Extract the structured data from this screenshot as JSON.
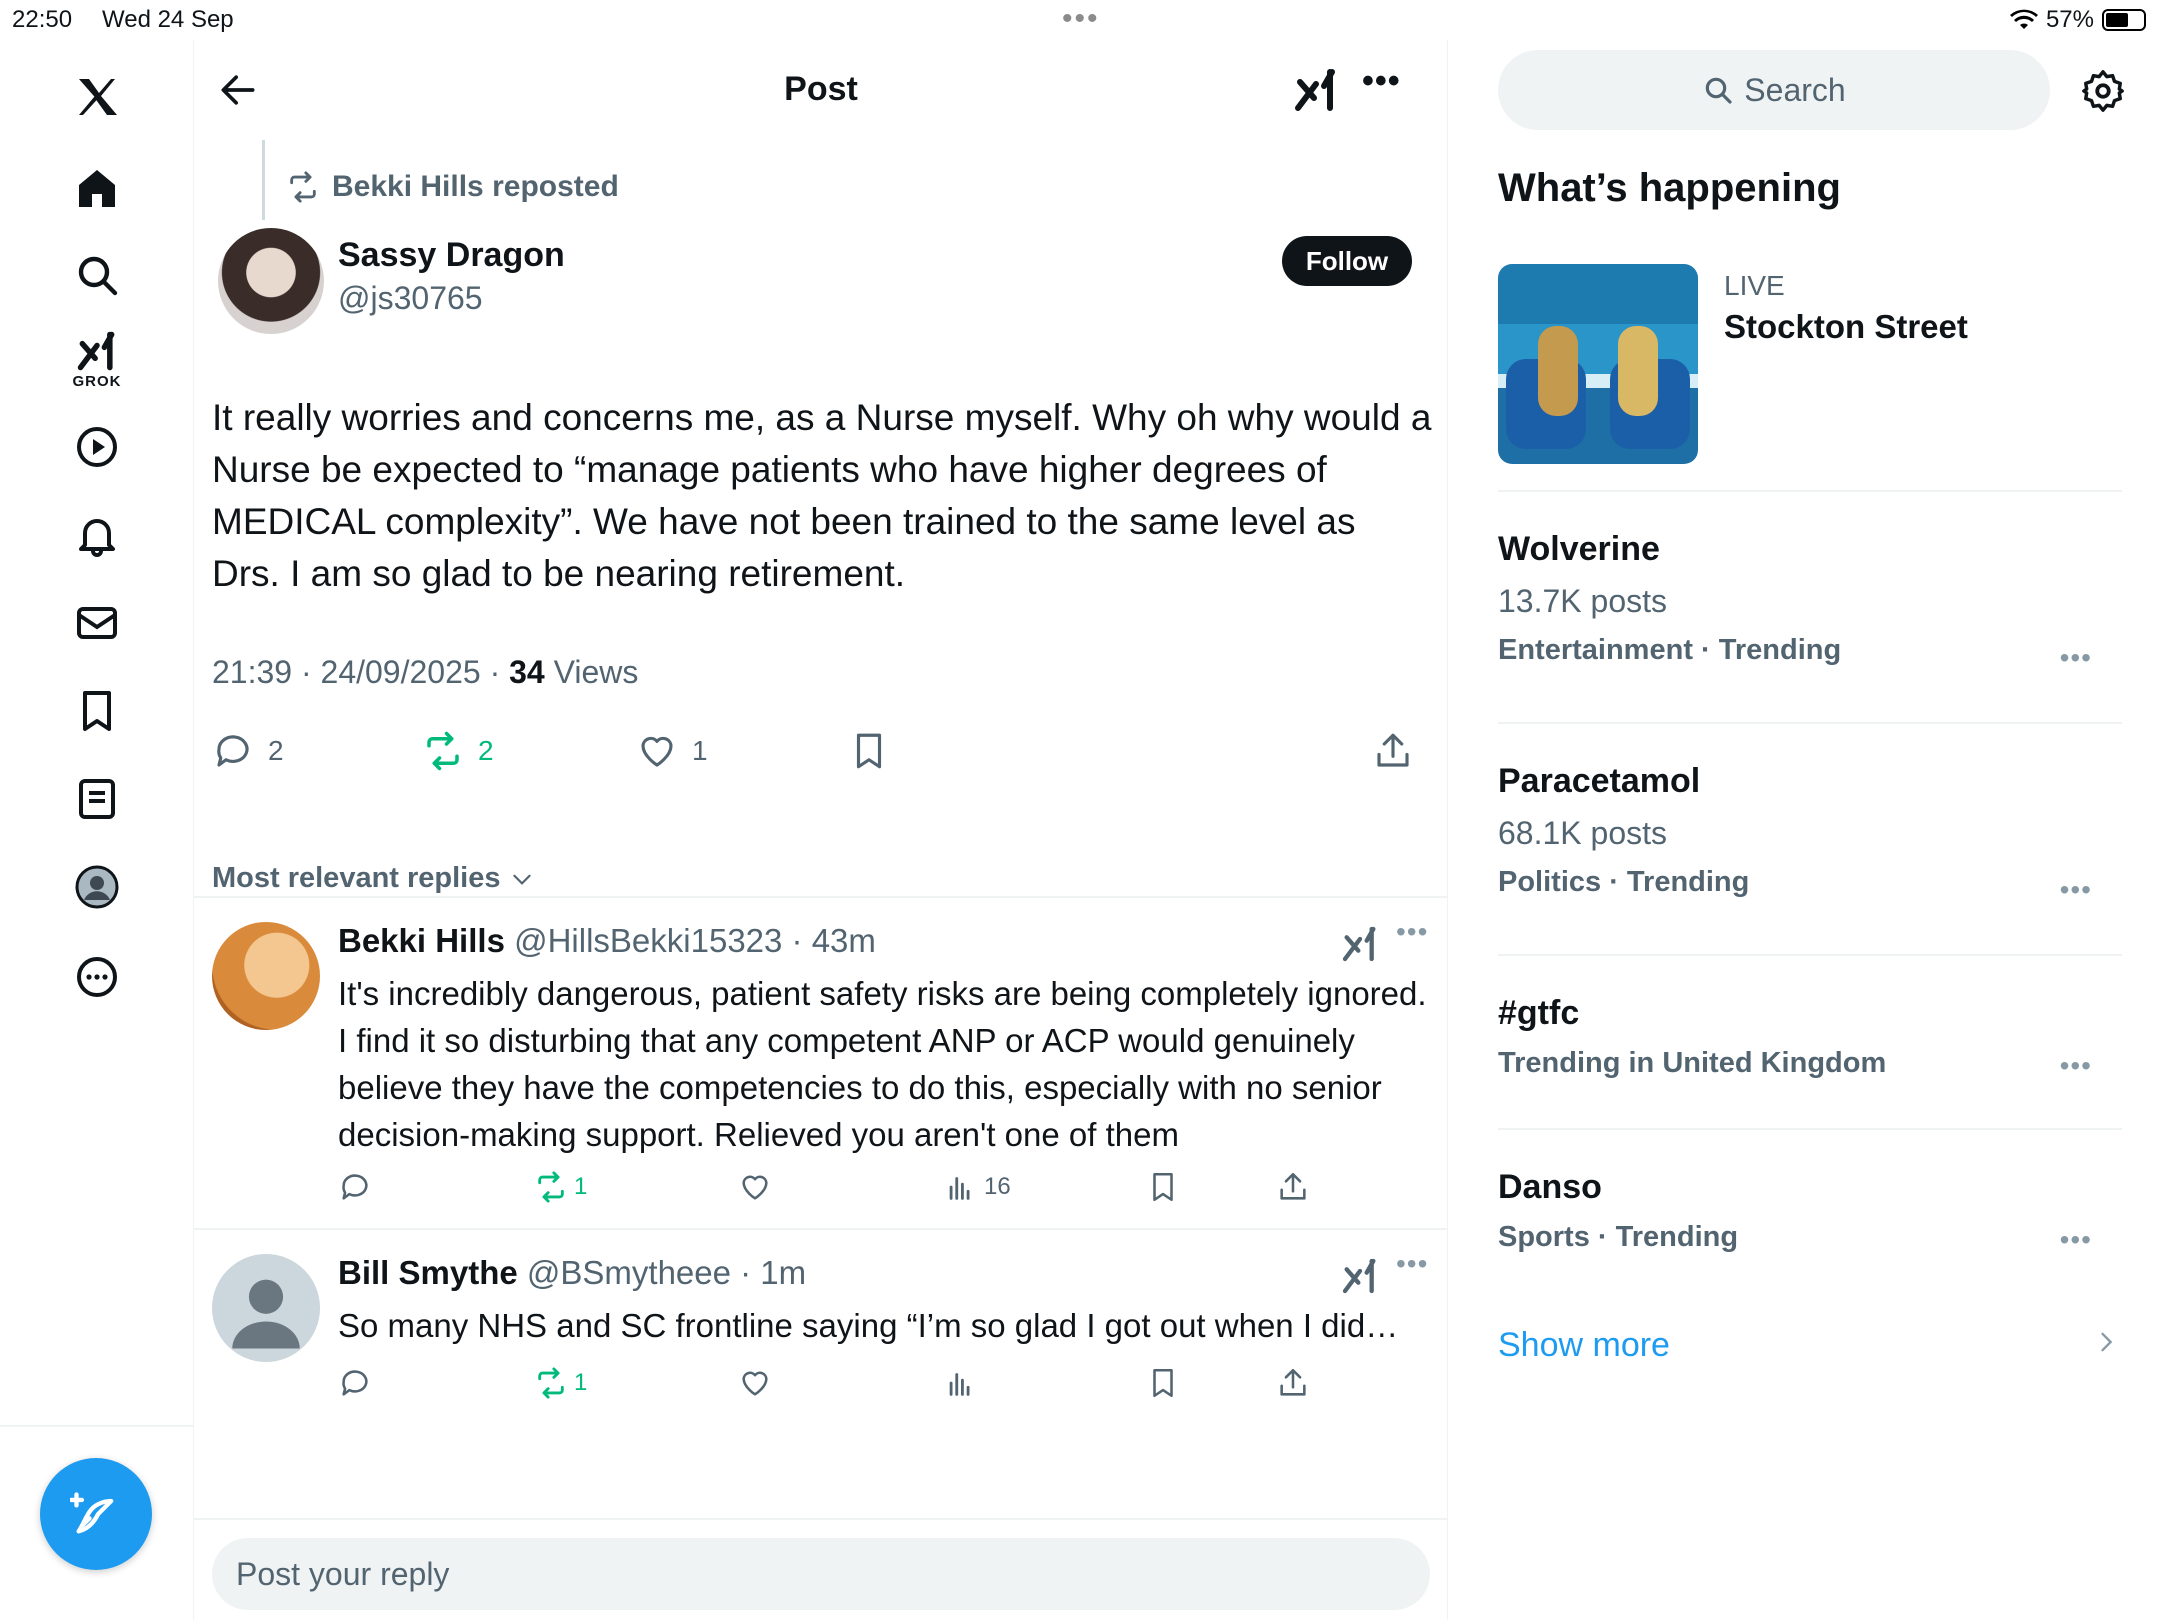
{
  "status": {
    "time": "22:50",
    "date": "Wed 24 Sep",
    "battery": "57%"
  },
  "nav": {
    "grok_label": "GROK"
  },
  "header": {
    "title": "Post"
  },
  "post": {
    "repost_label": "Bekki Hills reposted",
    "author_name": "Sassy Dragon",
    "author_handle": "@js30765",
    "follow_label": "Follow",
    "text": "It really worries and concerns me, as a Nurse myself. Why oh why would a Nurse be expected to “manage patients who have higher degrees of MEDICAL complexity”. We have not been trained to the same level as Drs. I am so glad to be nearing retirement.",
    "timestamp": "21:39 · 24/09/2025 · ",
    "views_count": "34",
    "views_label": " Views",
    "replies": "2",
    "reposts": "2",
    "likes": "1"
  },
  "sort_label": "Most relevant replies",
  "replies": [
    {
      "name": "Bekki Hills",
      "meta": " @HillsBekki15323 · 43m",
      "text": "It's incredibly dangerous, patient safety risks are being completely ignored. I find it so disturbing that any competent ANP or ACP would genuinely believe they have the competencies to do this, especially with no senior decision-making support. Relieved you aren't one of them",
      "reposts": "1",
      "views": "16"
    },
    {
      "name": "Bill Smythe",
      "meta": " @BSmytheee · 1m",
      "text": "So many NHS and SC frontline saying “I’m so glad I got out when I did…",
      "reposts": "1",
      "views": ""
    }
  ],
  "reply_placeholder": "Post your reply",
  "sidebar": {
    "search_placeholder": "Search",
    "section_title": "What’s happening",
    "live": {
      "label": "LIVE",
      "title": "Stockton Street"
    },
    "trends": [
      {
        "name": "Wolverine",
        "count": "13.7K posts",
        "category": "Entertainment · Trending"
      },
      {
        "name": "Paracetamol",
        "count": "68.1K posts",
        "category": "Politics · Trending"
      },
      {
        "name": "#gtfc",
        "count": "",
        "category": "Trending in United Kingdom"
      },
      {
        "name": "Danso",
        "count": "",
        "category": "Sports · Trending"
      }
    ],
    "show_more": "Show more"
  },
  "colors": {
    "accent": "#1d9bf0",
    "repost_green": "#00ba7c",
    "muted": "#536471",
    "text": "#0f1419"
  }
}
